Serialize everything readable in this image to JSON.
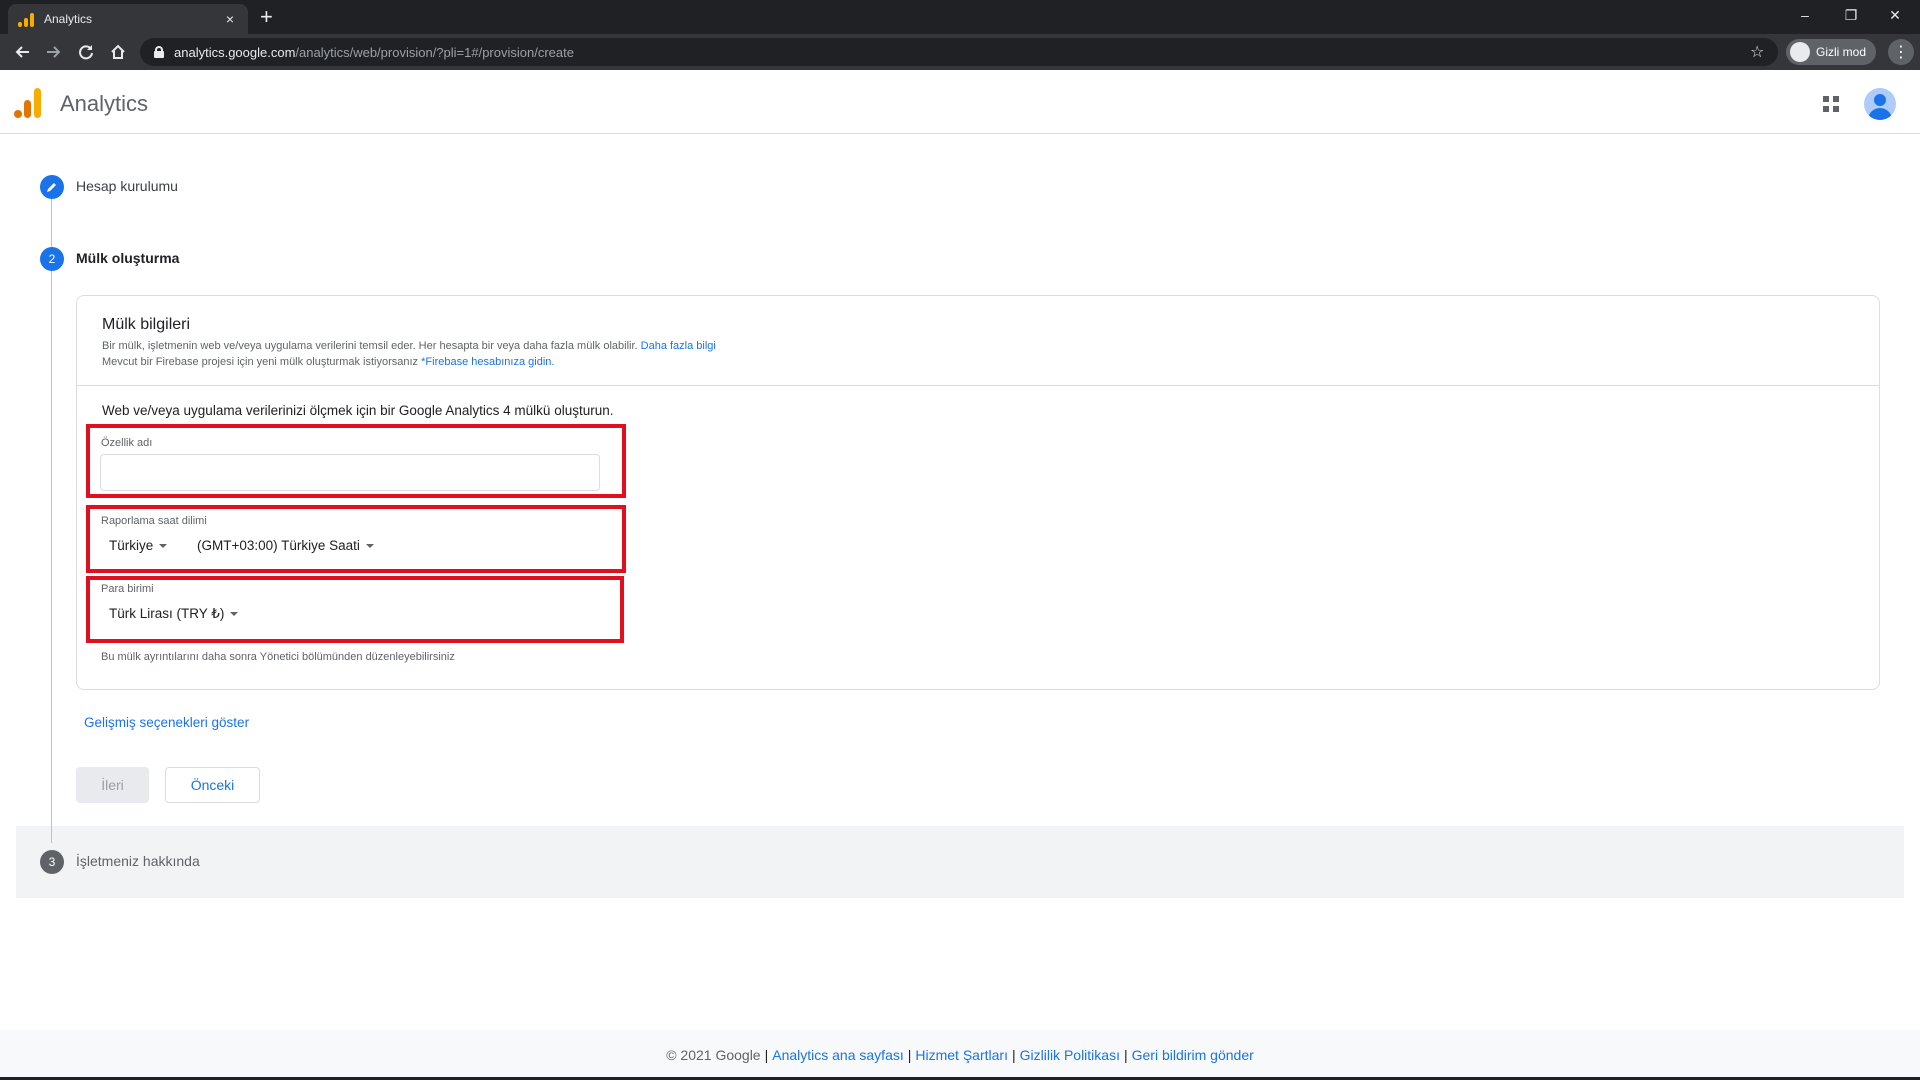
{
  "browser": {
    "tab_title": "Analytics",
    "tab_close": "×",
    "new_tab": "+",
    "url_host": "analytics.google.com",
    "url_path": "/analytics/web/provision/?pli=1#/provision/create",
    "incognito_label": "Gizli mod",
    "window_controls": {
      "minimize": "–",
      "restore": "❐",
      "close": "✕"
    }
  },
  "app": {
    "name": "Analytics"
  },
  "steps": [
    {
      "number": "",
      "label": "Hesap kurulumu",
      "state": "done"
    },
    {
      "number": "2",
      "label": "Mülk oluşturma",
      "state": "active"
    },
    {
      "number": "3",
      "label": "İşletmeniz hakkında",
      "state": "pending"
    }
  ],
  "card": {
    "title": "Mülk bilgileri",
    "desc_line1": "Bir mülk, işletmenin web ve/veya uygulama verilerini temsil eder. Her hesapta bir veya daha fazla mülk olabilir.",
    "desc_link1": "Daha fazla bilgi",
    "desc_line2": "Mevcut bir Firebase projesi için yeni mülk oluşturmak istiyorsanız",
    "desc_link2": "*Firebase hesabınıza gidin.",
    "intro": "Web ve/veya uygulama verilerinizi ölçmek için bir Google Analytics 4 mülkü oluşturun.",
    "property_name_label": "Özellik adı",
    "property_name_value": "",
    "timezone_label": "Raporlama saat dilimi",
    "country_value": "Türkiye",
    "timezone_value": "(GMT+03:00) Türkiye Saati",
    "currency_label": "Para birimi",
    "currency_value": "Türk Lirası (TRY ₺)",
    "hint": "Bu mülk ayrıntılarını daha sonra Yönetici bölümünden düzenleyebilirsiniz"
  },
  "advanced_link": "Gelişmiş seçenekleri göster",
  "buttons": {
    "next": "İleri",
    "previous": "Önceki"
  },
  "footer": {
    "copyright": "© 2021 Google",
    "links": [
      "Analytics ana sayfası",
      "Hizmet Şartları",
      "Gizlilik Politikası",
      "Geri bildirim gönder"
    ]
  },
  "colors": {
    "accent": "#1a73e8",
    "highlight": "#e0101f",
    "logo_dark": "#e37400",
    "logo_light": "#f9ab00"
  }
}
